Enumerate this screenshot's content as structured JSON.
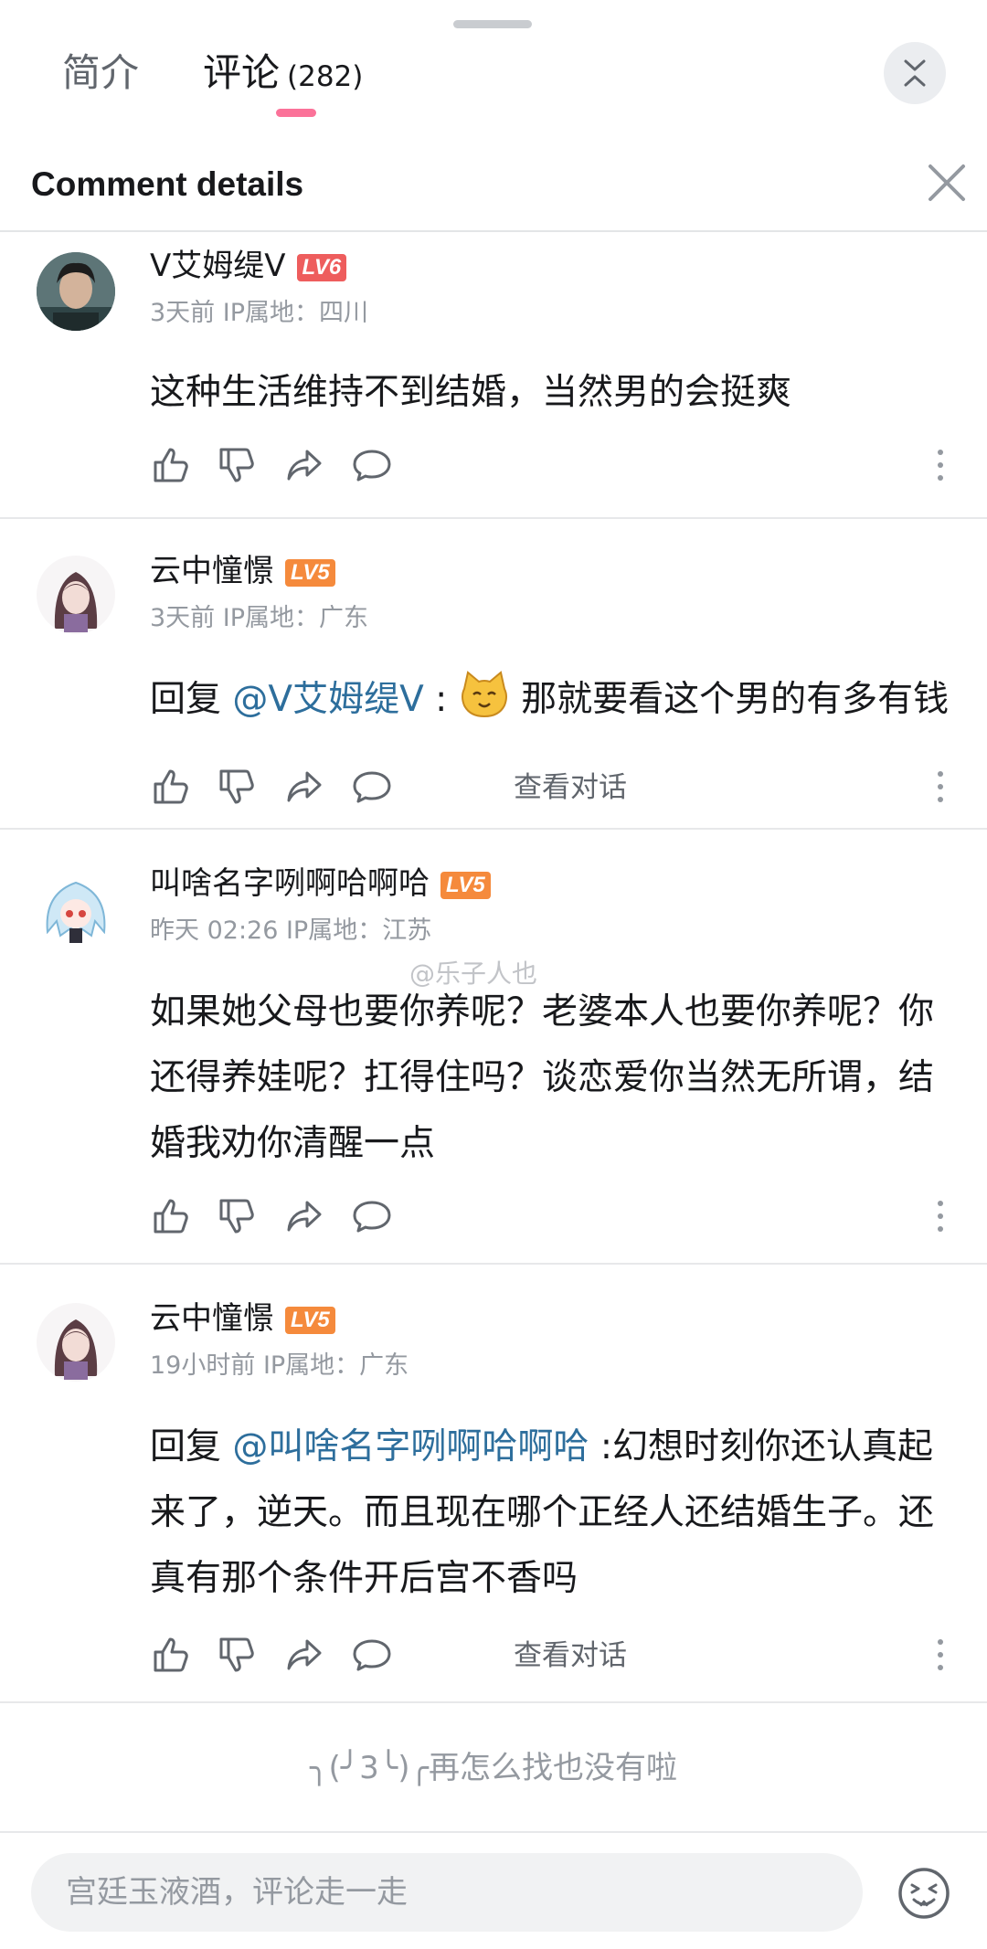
{
  "tabs": {
    "intro": "简介",
    "comments": "评论",
    "comments_count": "(282)"
  },
  "header": {
    "title": "Comment details"
  },
  "comments": [
    {
      "user": "V艾姆缇V",
      "level": "LV6",
      "meta": "3天前 IP属地：四川",
      "text": "这种生活维持不到结婚，当然男的会挺爽"
    },
    {
      "user": "云中憧憬",
      "level": "LV5",
      "meta": "3天前 IP属地：广东",
      "reply_prefix": "回复 ",
      "mention": "@V艾姆缇V",
      "text_after_mention": " :",
      "text": "那就要看这个男的有多有钱",
      "view_conversation": "查看对话"
    },
    {
      "user": "叫啥名字咧啊哈啊哈",
      "level": "LV5",
      "meta": "昨天 02:26 IP属地：江苏",
      "text": "如果她父母也要你养呢？老婆本人也要你养呢？你还得养娃呢？扛得住吗？谈恋爱你当然无所谓，结婚我劝你清醒一点"
    },
    {
      "user": "云中憧憬",
      "level": "LV5",
      "meta": "19小时前 IP属地：广东",
      "reply_prefix": "回复 ",
      "mention": "@叫啥名字咧啊哈啊哈",
      "text": " :幻想时刻你还认真起来了，逆天。而且现在哪个正经人还结婚生子。还真有那个条件开后宫不香吗",
      "view_conversation": "查看对话"
    }
  ],
  "end_message": "╮(╯3╰)╭再怎么找也没有啦",
  "watermark": "@乐子人也",
  "composer": {
    "placeholder": "宫廷玉液酒，评论走一走"
  },
  "icons": {
    "collapse": "chevron-collapse-icon",
    "close": "close-icon",
    "like": "thumbs-up-icon",
    "dislike": "thumbs-down-icon",
    "share": "share-icon",
    "reply": "comment-bubble-icon",
    "more": "more-vertical-icon",
    "emoji": "emoji-icon"
  },
  "colors": {
    "accent": "#fb7299",
    "mention": "#2d6e9c",
    "lv6": "#ee5d5d",
    "lv5": "#f58a3c"
  }
}
